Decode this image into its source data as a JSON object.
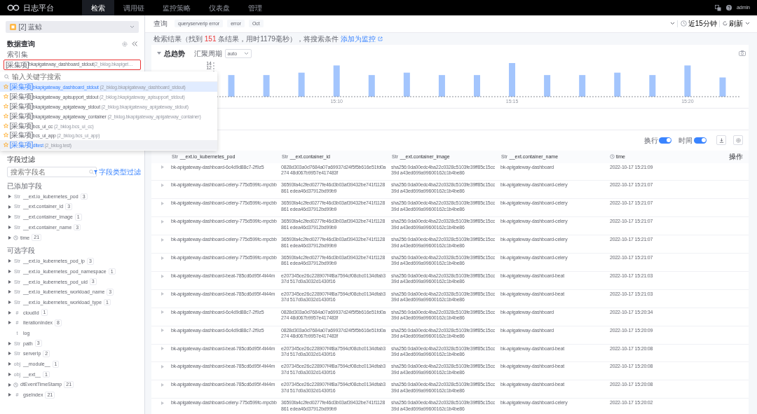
{
  "top_nav": {
    "app_title": "日志平台",
    "tabs": [
      {
        "label": "检索",
        "selected": true
      },
      {
        "label": "调用链",
        "selected": false
      },
      {
        "label": "监控策略",
        "selected": false
      },
      {
        "label": "仪表盘",
        "selected": false
      },
      {
        "label": "管理",
        "selected": false
      }
    ],
    "user": "admin"
  },
  "sidebar": {
    "business": "[2] 蓝鲸",
    "title": "数据查询",
    "index_label": "索引集",
    "index_set": {
      "tag": "[采集项]",
      "name": "bkapigateway_dashboard_stdout",
      "detail": "(2_bklog.bkapiget…"
    },
    "index_dropdown": {
      "placeholder": "输入关键字搜索",
      "items": [
        {
          "tag": "[采集项]",
          "name": "bkapigateway_dashboard_stdout",
          "detail": "(2_bklog.bkapigateway_dashboard_stdout)",
          "selected": true,
          "hovered": false
        },
        {
          "tag": "[采集项]",
          "name": "bkapigateway_apisupport_stdout",
          "detail": "(2_bklog.bkapigateway_apisupport_stdout)",
          "selected": false,
          "hovered": false
        },
        {
          "tag": "[采集项]",
          "name": "bkapigateway_apigateway_stdout",
          "detail": "(2_bklog.bkapigateway_apigateway_stdout)",
          "selected": false,
          "hovered": false
        },
        {
          "tag": "[采集项]",
          "name": "bkapigateway_apigateway_container",
          "detail": "(2_bklog.bkapigateway_apigateway_container)",
          "selected": false,
          "hovered": false
        },
        {
          "tag": "[采集项]",
          "name": "bcs_ui_cc",
          "detail": "(2_bklog.bcs_ui_cc)",
          "selected": false,
          "hovered": false
        },
        {
          "tag": "[采集项]",
          "name": "bcs_ui_app",
          "detail": "(2_bklog.bcs_ui_app)",
          "selected": false,
          "hovered": false
        },
        {
          "tag": "[采集项]",
          "name": "dltest",
          "detail": "(2_bklog.test)",
          "selected": false,
          "hovered": true
        }
      ]
    },
    "field_filter": {
      "title": "字段过滤",
      "placeholder": "搜索字段名",
      "type_filter": "字段类型过滤"
    },
    "field_groups": [
      {
        "title": "已添加字段",
        "fields": [
          {
            "kind": "str",
            "type_glyph": "Str",
            "name": "__ext.io_kubernetes_pod",
            "count": "3",
            "expandable": true
          },
          {
            "kind": "str",
            "type_glyph": "Str",
            "name": "__ext.container_id",
            "count": "3",
            "expandable": true
          },
          {
            "kind": "str",
            "type_glyph": "Str",
            "name": "__ext.container_image",
            "count": "1",
            "expandable": true
          },
          {
            "kind": "str",
            "type_glyph": "Str",
            "name": "__ext.container_name",
            "count": "3",
            "expandable": true
          },
          {
            "kind": "time",
            "name": "time",
            "count": "21",
            "expandable": true
          }
        ]
      },
      {
        "title": "可选字段",
        "fields": [
          {
            "kind": "str",
            "type_glyph": "Str",
            "name": "__ext.io_kubernetes_pod_ip",
            "count": "3",
            "expandable": true
          },
          {
            "kind": "str",
            "type_glyph": "Str",
            "name": "__ext.io_kubernetes_pod_namespace",
            "count": "1",
            "expandable": true
          },
          {
            "kind": "str",
            "type_glyph": "Str",
            "name": "__ext.io_kubernetes_pod_uid",
            "count": "3",
            "expandable": true
          },
          {
            "kind": "str",
            "type_glyph": "Str",
            "name": "__ext.io_kubernetes_workload_name",
            "count": "3",
            "expandable": true
          },
          {
            "kind": "str",
            "type_glyph": "Str",
            "name": "__ext.io_kubernetes_workload_type",
            "count": "1",
            "expandable": true
          },
          {
            "kind": "num",
            "type_glyph": "#",
            "name": "cloudId",
            "count": "1",
            "expandable": true
          },
          {
            "kind": "num",
            "type_glyph": "#",
            "name": "iterationIndex",
            "count": "8",
            "expandable": true
          },
          {
            "kind": "text",
            "type_glyph": "t",
            "name": "log",
            "expandable": false
          },
          {
            "kind": "str",
            "type_glyph": "Str",
            "name": "path",
            "count": "3",
            "expandable": true
          },
          {
            "kind": "str",
            "type_glyph": "Str",
            "name": "serverIp",
            "count": "2",
            "expandable": true
          },
          {
            "kind": "obj",
            "type_glyph": "obj",
            "name": "__module__",
            "count": "1",
            "expandable": true
          },
          {
            "kind": "obj",
            "type_glyph": "obj",
            "name": "__ext__",
            "count": "1",
            "expandable": true
          },
          {
            "kind": "time",
            "name": "dtEventTimeStamp",
            "count": "21",
            "expandable": true
          },
          {
            "kind": "num",
            "type_glyph": "#",
            "name": "gseIndex",
            "count": "21",
            "expandable": true
          }
        ]
      }
    ]
  },
  "query_bar": {
    "label": "查询",
    "tags": [
      "queryserverip error",
      "error",
      "Oct"
    ],
    "time_range": "近15分钟",
    "refresh": "刷新"
  },
  "result_summary": {
    "prefix": "检索结果（找到 ",
    "count": "151",
    "suffix": " 条结果，用时1179毫秒），将搜索条件 ",
    "link": "添加为监控"
  },
  "trend": {
    "title": "总趋势",
    "interval_label": "汇聚周期",
    "interval": "auto",
    "chart_data": {
      "type": "bar",
      "categories": [
        null,
        null,
        null,
        "15:10",
        null,
        null,
        null,
        null,
        "15:15",
        null,
        null,
        null,
        null,
        "15:20",
        null
      ],
      "values": [
        9,
        9,
        10,
        13,
        9,
        10,
        9,
        9,
        14,
        9,
        9,
        10,
        9,
        13,
        8
      ],
      "ylim": [
        0,
        14
      ],
      "yticks": [
        12,
        14
      ]
    }
  },
  "table": {
    "toggles": [
      {
        "label": "换行",
        "on": true
      },
      {
        "label": "时间",
        "on": true
      }
    ],
    "columns": [
      {
        "kind": "str",
        "type_glyph": "Str",
        "label": "__ext.io_kubernetes_pod"
      },
      {
        "kind": "str",
        "type_glyph": "Str",
        "label": "__ext.container_id"
      },
      {
        "kind": "str",
        "type_glyph": "Str",
        "label": "__ext.container_image"
      },
      {
        "kind": "str",
        "type_glyph": "Str",
        "label": "__ext.container_name"
      },
      {
        "kind": "time",
        "label": "time"
      },
      {
        "kind": "action",
        "label": "操作"
      }
    ],
    "rows": [
      {
        "cells": [
          "bk-apigateway-dashboard-6c4d9d88c7-2f9z5",
          "0828d303a0d7684a07a69937d24f5f5b616e51fd0a274 48d067b9957e417483f",
          "sha256:0da00edc4ba22c0328c5103fe39ff85c15cc39d a43ed699a99600162c1b4be86",
          "bk-apigateway-dashboard",
          "2022-10-17 15:21:09"
        ]
      },
      {
        "cells": [
          "bk-apigateway-dashboard-celery-775d599fc-mpcbb",
          "36593fa4c2fed0277fe46d3b03af39432be741f1128861 edea46d37912bd99b9",
          "sha256:0da00edc4ba22c0328c5103fe39ff85c15cc39d a43ed699a99600162c1b4be86",
          "bk-apigateway-dashboard-celery",
          "2022-10-17 15:21:07"
        ]
      },
      {
        "cells": [
          "bk-apigateway-dashboard-celery-775d599fc-mpcbb",
          "36593fa4c2fed0277fe46d3b03af39432be741f1128861 edea46d37912bd99b9",
          "sha256:0da00edc4ba22c0328c5103fe39ff85c15cc39d a43ed699a99600162c1b4be86",
          "bk-apigateway-dashboard-celery",
          "2022-10-17 15:21:07"
        ]
      },
      {
        "cells": [
          "bk-apigateway-dashboard-celery-775d599fc-mpcbb",
          "36593fa4c2fed0277fe46d3b03af39432be741f1128861 edea46d37912bd99b9",
          "sha256:0da00edc4ba22c0328c5103fe39ff85c15cc39d a43ed699a99600162c1b4be86",
          "bk-apigateway-dashboard-celery",
          "2022-10-17 15:21:07"
        ]
      },
      {
        "cells": [
          "bk-apigateway-dashboard-celery-775d599fc-mpcbb",
          "36593fa4c2fed0277fe46d3b03af39432be741f1128861 edea46d37912bd99b9",
          "sha256:0da00edc4ba22c0328c5103fe39ff85c15cc39d a43ed699a99600162c1b4be86",
          "bk-apigateway-dashboard-celery",
          "2022-10-17 15:21:07"
        ]
      },
      {
        "cells": [
          "bk-apigateway-dashboard-celery-775d599fc-mpcbb",
          "36593fa4c2fed0277fe46d3b03af39432be741f1128861 edea46d37912bd99b9",
          "sha256:0da00edc4ba22c0328c5103fe39ff85c15cc39d a43ed699a99600162c1b4be86",
          "bk-apigateway-dashboard-celery",
          "2022-10-17 15:21:07"
        ]
      },
      {
        "cells": [
          "bk-apigateway-dashboard-beat-785cd6d95f-4t44m",
          "e207345ce26c228907f4f8a7594cf08cbc0134dfab337d 517d0a3032d1430f16",
          "sha256:0da00edc4ba22c0328c5103fe39ff85c15cc39d a43ed699a99600162c1b4be86",
          "bk-apigateway-dashboard-beat",
          "2022-10-17 15:21:03"
        ]
      },
      {
        "cells": [
          "bk-apigateway-dashboard-beat-785cd6d95f-4t44m",
          "e207345ce26c228907f4f8a7594cf08cbc0134dfab337d 517d0a3032d1430f16",
          "sha256:0da00edc4ba22c0328c5103fe39ff85c15cc39d a43ed699a99600162c1b4be86",
          "bk-apigateway-dashboard-beat",
          "2022-10-17 15:21:03"
        ]
      },
      {
        "cells": [
          "bk-apigateway-dashboard-6c4d9d88c7-2f9z5",
          "0828d303a0d7684a07a69937d24f5f5b616e51fd0a274 48d067b9957e417483f",
          "sha256:0da00edc4ba22c0328c5103fe39ff85c15cc39d a43ed699a99600162c1b4be86",
          "bk-apigateway-dashboard",
          "2022-10-17 15:20:34"
        ]
      },
      {
        "cells": [
          "bk-apigateway-dashboard-6c4d9d88c7-2f9z5",
          "0828d303a0d7684a07a69937d24f5f5b616e51fd0a274 48d067b9957e417483f",
          "sha256:0da00edc4ba22c0328c5103fe39ff85c15cc39d a43ed699a99600162c1b4be86",
          "bk-apigateway-dashboard",
          "2022-10-17 15:20:09"
        ]
      },
      {
        "cells": [
          "bk-apigateway-dashboard-beat-785cd6d95f-4t44m",
          "e207345ce26c228907f4f8a7594cf08cbc0134dfab337d 517d0a3032d1430f16",
          "sha256:0da00edc4ba22c0328c5103fe39ff85c15cc39d a43ed699a99600162c1b4be86",
          "bk-apigateway-dashboard-beat",
          "2022-10-17 15:20:08"
        ]
      },
      {
        "cells": [
          "bk-apigateway-dashboard-beat-785cd6d95f-4t44m",
          "e207345ce26c228907f4f8a7594cf08cbc0134dfab337d 517d0a3032d1430f16",
          "sha256:0da00edc4ba22c0328c5103fe39ff85c15cc39d a43ed699a99600162c1b4be86",
          "bk-apigateway-dashboard-beat",
          "2022-10-17 15:20:08"
        ]
      },
      {
        "cells": [
          "bk-apigateway-dashboard-beat-785cd6d95f-4t44m",
          "e207345ce26c228907f4f8a7594cf08cbc0134dfab337d 517d0a3032d1430f16",
          "sha256:0da00edc4ba22c0328c5103fe39ff85c15cc39d a43ed699a99600162c1b4be86",
          "bk-apigateway-dashboard-beat",
          "2022-10-17 15:20:08"
        ]
      },
      {
        "cells": [
          "bk-apigateway-dashboard-celery-775d599fc-mpcbb",
          "36593fa4c2fed0277fe46d3b03af39432be741f1128861 edea46d37912bd99b9",
          "sha256:0da00edc4ba22c0328c5103fe39ff85c15cc39d a43ed699a99600162c1b4be86",
          "bk-apigateway-dashboard-celery",
          "2022-10-17 15:20:02"
        ]
      }
    ]
  }
}
